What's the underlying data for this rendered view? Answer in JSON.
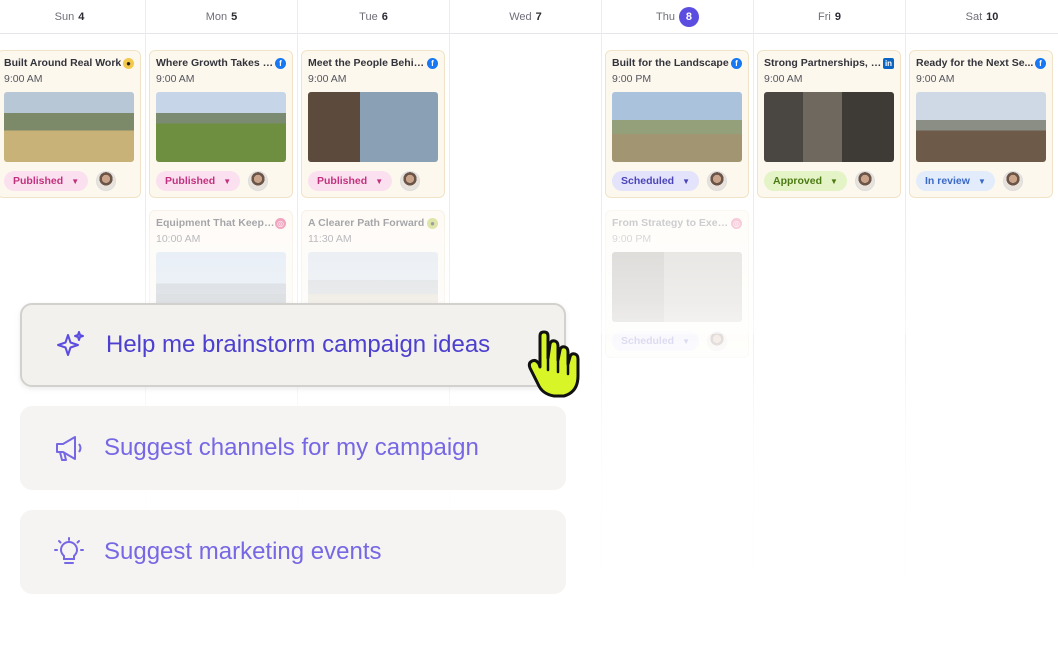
{
  "days": [
    {
      "name": "Sun",
      "num": "4",
      "today": false
    },
    {
      "name": "Mon",
      "num": "5",
      "today": false
    },
    {
      "name": "Tue",
      "num": "6",
      "today": false
    },
    {
      "name": "Wed",
      "num": "7",
      "today": false
    },
    {
      "name": "Thu",
      "num": "8",
      "today": true
    },
    {
      "name": "Fri",
      "num": "9",
      "today": false
    },
    {
      "name": "Sat",
      "num": "10",
      "today": false
    }
  ],
  "posts": {
    "sun1": {
      "title": "Built Around Real Work",
      "time": "9:00 AM",
      "network": "mailchimp-icon",
      "status": "Published"
    },
    "mon1": {
      "title": "Where Growth Takes R...",
      "time": "9:00 AM",
      "network": "facebook-icon",
      "status": "Published"
    },
    "mon2": {
      "title": "Equipment That Keeps...",
      "time": "10:00 AM",
      "network": "instagram-icon"
    },
    "tue1": {
      "title": "Meet the People Behin...",
      "time": "9:00 AM",
      "network": "facebook-icon",
      "status": "Published"
    },
    "tue2": {
      "title": "A Clearer Path Forward",
      "time": "11:30 AM",
      "network": "mailchimp-icon"
    },
    "thu1": {
      "title": "Built for the Landscape",
      "time": "9:00 PM",
      "network": "facebook-icon",
      "status": "Scheduled"
    },
    "thu2": {
      "title": "From Strategy to Exec...",
      "time": "9:00 PM",
      "network": "instagram-icon",
      "status": "Scheduled"
    },
    "fri1": {
      "title": "Strong Partnerships, B...",
      "time": "9:00 AM",
      "network": "linkedin-icon",
      "status": "Approved"
    },
    "sat1": {
      "title": "Ready for the Next Se...",
      "time": "9:00 AM",
      "network": "facebook-icon",
      "status": "In review"
    }
  },
  "prompts": {
    "brainstorm": "Help me brainstorm campaign ideas",
    "channels": "Suggest channels for my campaign",
    "events": "Suggest marketing events"
  },
  "colors": {
    "accent": "#5b4de0",
    "published": "#c2317f",
    "scheduled": "#4b44b8",
    "approved": "#4b7a13",
    "in_review": "#3b69c6",
    "cursor": "#d8f528"
  }
}
